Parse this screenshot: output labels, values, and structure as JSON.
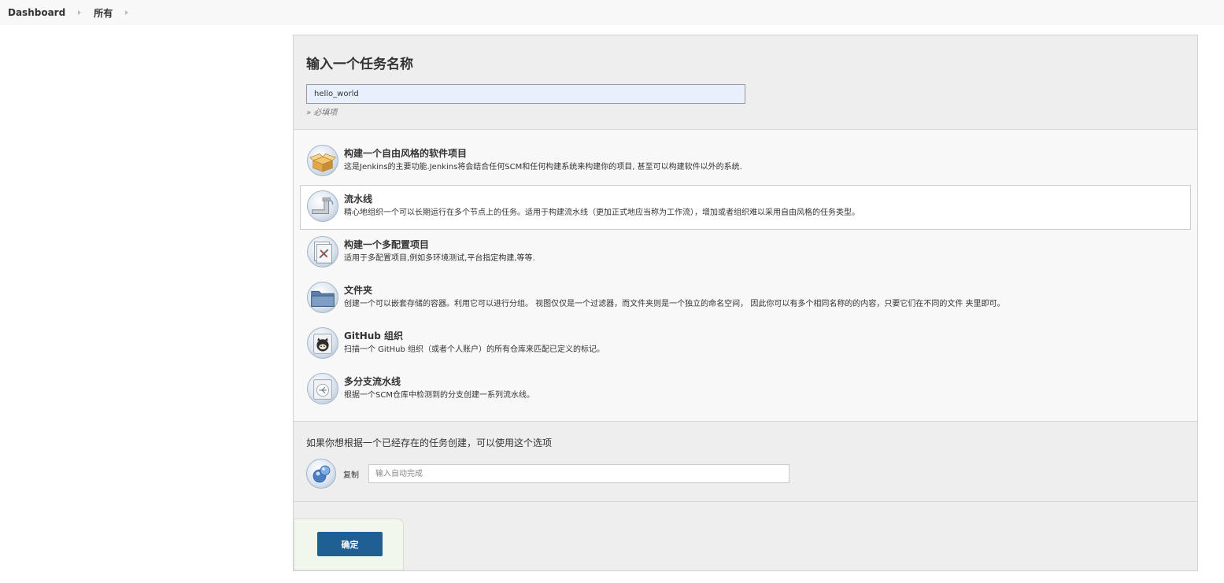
{
  "breadcrumb": {
    "items": [
      "Dashboard",
      "所有"
    ]
  },
  "form": {
    "title": "输入一个任务名称",
    "name_value": "hello_world",
    "required_hint": "» 必填项"
  },
  "item_types": [
    {
      "name": "构建一个自由风格的软件项目",
      "desc": "这是Jenkins的主要功能.Jenkins将会结合任何SCM和任何构建系统来构建你的项目, 甚至可以构建软件以外的系统.",
      "icon": "freestyle-box-icon",
      "selected": false
    },
    {
      "name": "流水线",
      "desc": "精心地组织一个可以长期运行在多个节点上的任务。适用于构建流水线（更加正式地应当称为工作流），增加或者组织难以采用自由风格的任务类型。",
      "icon": "pipeline-icon",
      "selected": true
    },
    {
      "name": "构建一个多配置项目",
      "desc": "适用于多配置项目,例如多环境测试,平台指定构建,等等.",
      "icon": "multi-config-icon",
      "selected": false
    },
    {
      "name": "文件夹",
      "desc": "创建一个可以嵌套存储的容器。利用它可以进行分组。 视图仅仅是一个过滤器，而文件夹则是一个独立的命名空间， 因此你可以有多个相同名称的的内容，只要它们在不同的文件 夹里即可。",
      "icon": "folder-icon",
      "selected": false
    },
    {
      "name": "GitHub 组织",
      "desc": "扫描一个 GitHub 组织（或者个人账户）的所有仓库来匹配已定义的标记。",
      "icon": "github-icon",
      "selected": false
    },
    {
      "name": "多分支流水线",
      "desc": "根据一个SCM仓库中检测到的分支创建一系列流水线。",
      "icon": "multibranch-icon",
      "selected": false
    }
  ],
  "copy": {
    "hint": "如果你想根据一个已经存在的任务创建，可以使用这个选项",
    "label": "复制",
    "placeholder": "输入自动完成"
  },
  "footer": {
    "ok_label": "确定"
  },
  "colors": {
    "ok_button": "#1f5f93",
    "panel_bg": "#eeeeee",
    "list_bg": "#f8f8f8"
  }
}
